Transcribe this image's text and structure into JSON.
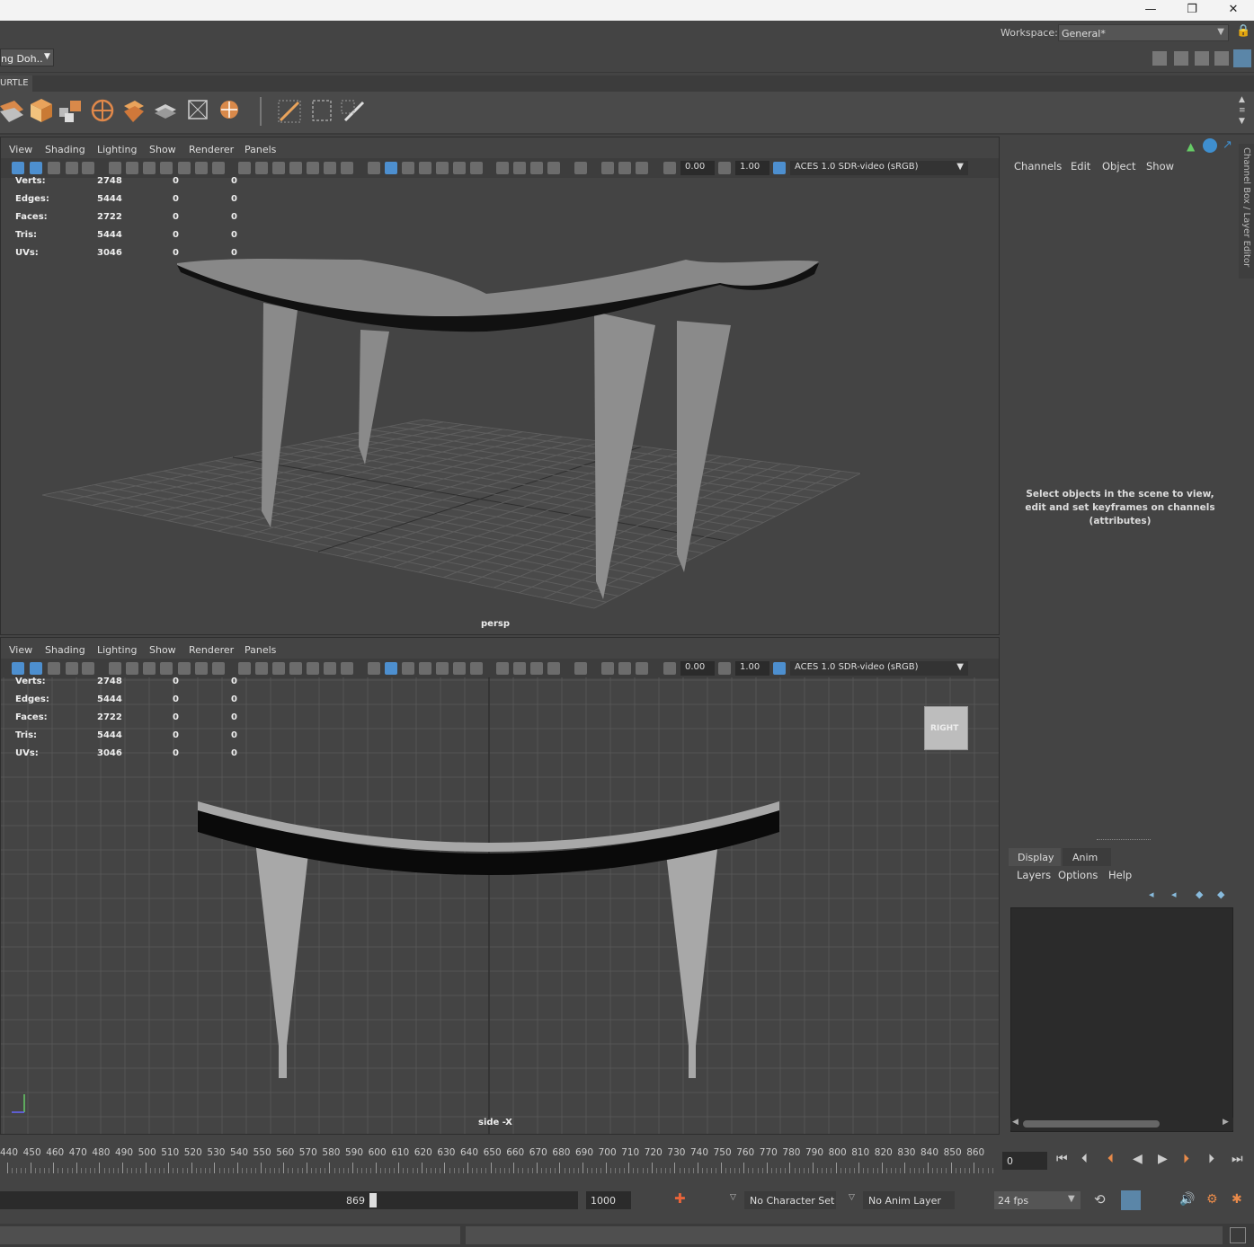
{
  "window": {
    "minimize": "—",
    "maximize": "❐",
    "close": "✕"
  },
  "workspace": {
    "label": "Workspace:",
    "value": "General*"
  },
  "menu2": {
    "dropdown": "ng Doh.."
  },
  "shelf": {
    "tab": "URTLE"
  },
  "viewport_menu": [
    "View",
    "Shading",
    "Lighting",
    "Show",
    "Renderer",
    "Panels"
  ],
  "viewport_tools": {
    "exposure": "0.00",
    "gamma": "1.00",
    "colorspace": "ACES 1.0 SDR-video (sRGB)"
  },
  "hud": {
    "rows": [
      {
        "label": "Verts:",
        "v1": "2748",
        "v2": "0",
        "v3": "0"
      },
      {
        "label": "Edges:",
        "v1": "5444",
        "v2": "0",
        "v3": "0"
      },
      {
        "label": "Faces:",
        "v1": "2722",
        "v2": "0",
        "v3": "0"
      },
      {
        "label": "Tris:",
        "v1": "5444",
        "v2": "0",
        "v3": "0"
      },
      {
        "label": "UVs:",
        "v1": "3046",
        "v2": "0",
        "v3": "0"
      }
    ]
  },
  "viewports": {
    "top_label": "persp",
    "bottom_label": "side -X",
    "viewcube": "RIGHT"
  },
  "channel_box": {
    "menu": [
      "Channels",
      "Edit",
      "Object",
      "Show"
    ],
    "message_line1": "Select objects in the scene to view,",
    "message_line2": "edit and set keyframes on channels",
    "message_line3": "(attributes)",
    "side_tab": "Channel Box / Layer Editor"
  },
  "layer_editor": {
    "tabs": [
      "Display",
      "Anim"
    ],
    "menu": [
      "Layers",
      "Options",
      "Help"
    ]
  },
  "timeline": {
    "ticks": [
      "440",
      "450",
      "460",
      "470",
      "480",
      "490",
      "500",
      "510",
      "520",
      "530",
      "540",
      "550",
      "560",
      "570",
      "580",
      "590",
      "600",
      "610",
      "620",
      "630",
      "640",
      "650",
      "660",
      "670",
      "680",
      "690",
      "700",
      "710",
      "720",
      "730",
      "740",
      "750",
      "760",
      "770",
      "780",
      "790",
      "800",
      "810",
      "820",
      "830",
      "840",
      "850",
      "860"
    ],
    "current_frame": "0"
  },
  "range": {
    "current": "869",
    "end": "1000",
    "character_set": "No Character Set",
    "anim_layer": "No Anim Layer",
    "fps": "24 fps"
  }
}
